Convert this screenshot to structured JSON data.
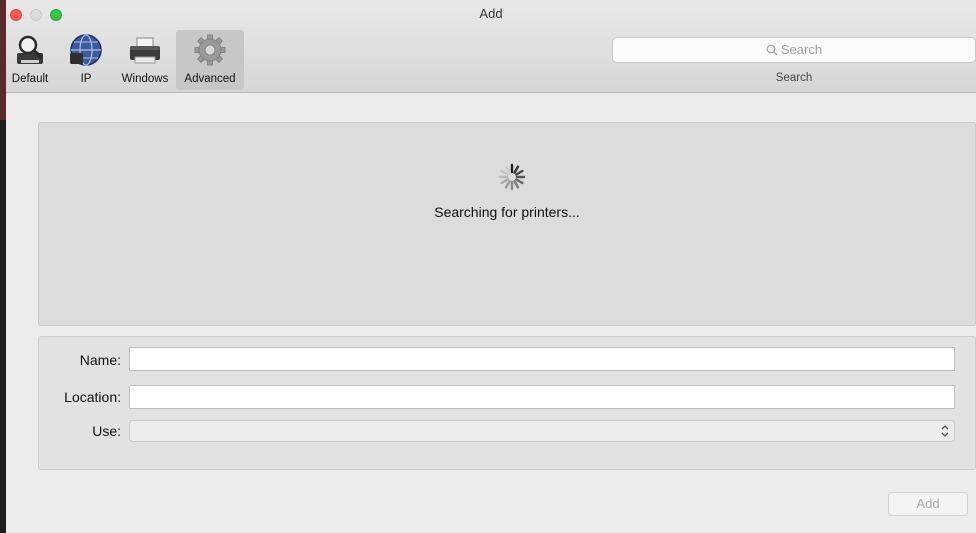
{
  "window": {
    "title": "Add"
  },
  "toolbar": {
    "tools": [
      {
        "label": "Default",
        "icon": "magnifier-printer-icon",
        "selected": false
      },
      {
        "label": "IP",
        "icon": "globe-icon",
        "selected": false
      },
      {
        "label": "Windows",
        "icon": "printer-icon",
        "selected": false
      },
      {
        "label": "Advanced",
        "icon": "gear-icon",
        "selected": true
      }
    ],
    "search": {
      "placeholder": "Search",
      "caption": "Search"
    }
  },
  "results": {
    "status": "Searching for printers..."
  },
  "form": {
    "name_label": "Name:",
    "name_value": "",
    "location_label": "Location:",
    "location_value": "",
    "use_label": "Use:",
    "use_value": ""
  },
  "footer": {
    "add_label": "Add"
  },
  "colors": {
    "close": "#fc5753",
    "minimize": "#dcdcdc",
    "zoom": "#33c748",
    "selected_tool": "#c7c7c7"
  }
}
